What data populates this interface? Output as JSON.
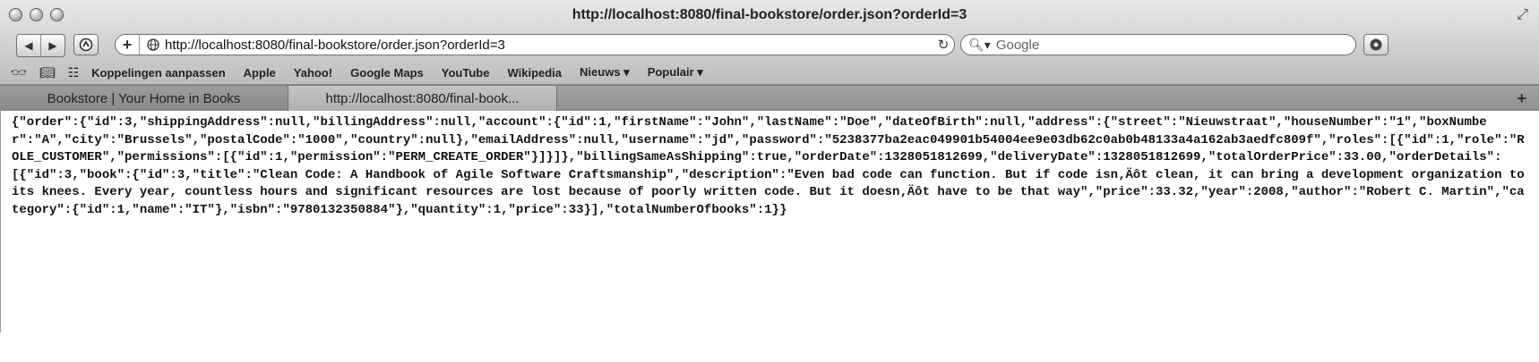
{
  "window": {
    "title": "http://localhost:8080/final-bookstore/order.json?orderId=3"
  },
  "toolbar": {
    "back_icon": "back-arrow-icon",
    "forward_icon": "forward-arrow-icon",
    "address_value": "http://localhost:8080/final-bookstore/order.json?orderId=3",
    "search_placeholder": "Google"
  },
  "bookmarks": {
    "items": [
      "Koppelingen aanpassen",
      "Apple",
      "Yahoo!",
      "Google Maps",
      "YouTube",
      "Wikipedia",
      "Nieuws ▾",
      "Populair ▾"
    ]
  },
  "tabs": [
    {
      "label": "Bookstore | Your Home in Books",
      "active": false
    },
    {
      "label": "http://localhost:8080/final-book...",
      "active": true
    }
  ],
  "page": {
    "json_text": "{\"order\":{\"id\":3,\"shippingAddress\":null,\"billingAddress\":null,\"account\":{\"id\":1,\"firstName\":\"John\",\"lastName\":\"Doe\",\"dateOfBirth\":null,\"address\":{\"street\":\"Nieuwstraat\",\"houseNumber\":\"1\",\"boxNumber\":\"A\",\"city\":\"Brussels\",\"postalCode\":\"1000\",\"country\":null},\"emailAddress\":null,\"username\":\"jd\",\"password\":\"5238377ba2eac049901b54004ee9e03db62c0ab0b48133a4a162ab3aedfc809f\",\"roles\":[{\"id\":1,\"role\":\"ROLE_CUSTOMER\",\"permissions\":[{\"id\":1,\"permission\":\"PERM_CREATE_ORDER\"}]}]},\"billingSameAsShipping\":true,\"orderDate\":1328051812699,\"deliveryDate\":1328051812699,\"totalOrderPrice\":33.00,\"orderDetails\":[{\"id\":3,\"book\":{\"id\":3,\"title\":\"Clean Code: A Handbook of Agile Software Craftsmanship\",\"description\":\"Even bad code can function. But if code isn‚Äôt clean, it can bring a development organization to its knees. Every year, countless hours and significant resources are lost because of poorly written code. But it doesn‚Äôt have to be that way\",\"price\":33.32,\"year\":2008,\"author\":\"Robert C. Martin\",\"category\":{\"id\":1,\"name\":\"IT\"},\"isbn\":\"9780132350884\"},\"quantity\":1,\"price\":33}],\"totalNumberOfbooks\":1}}"
  }
}
